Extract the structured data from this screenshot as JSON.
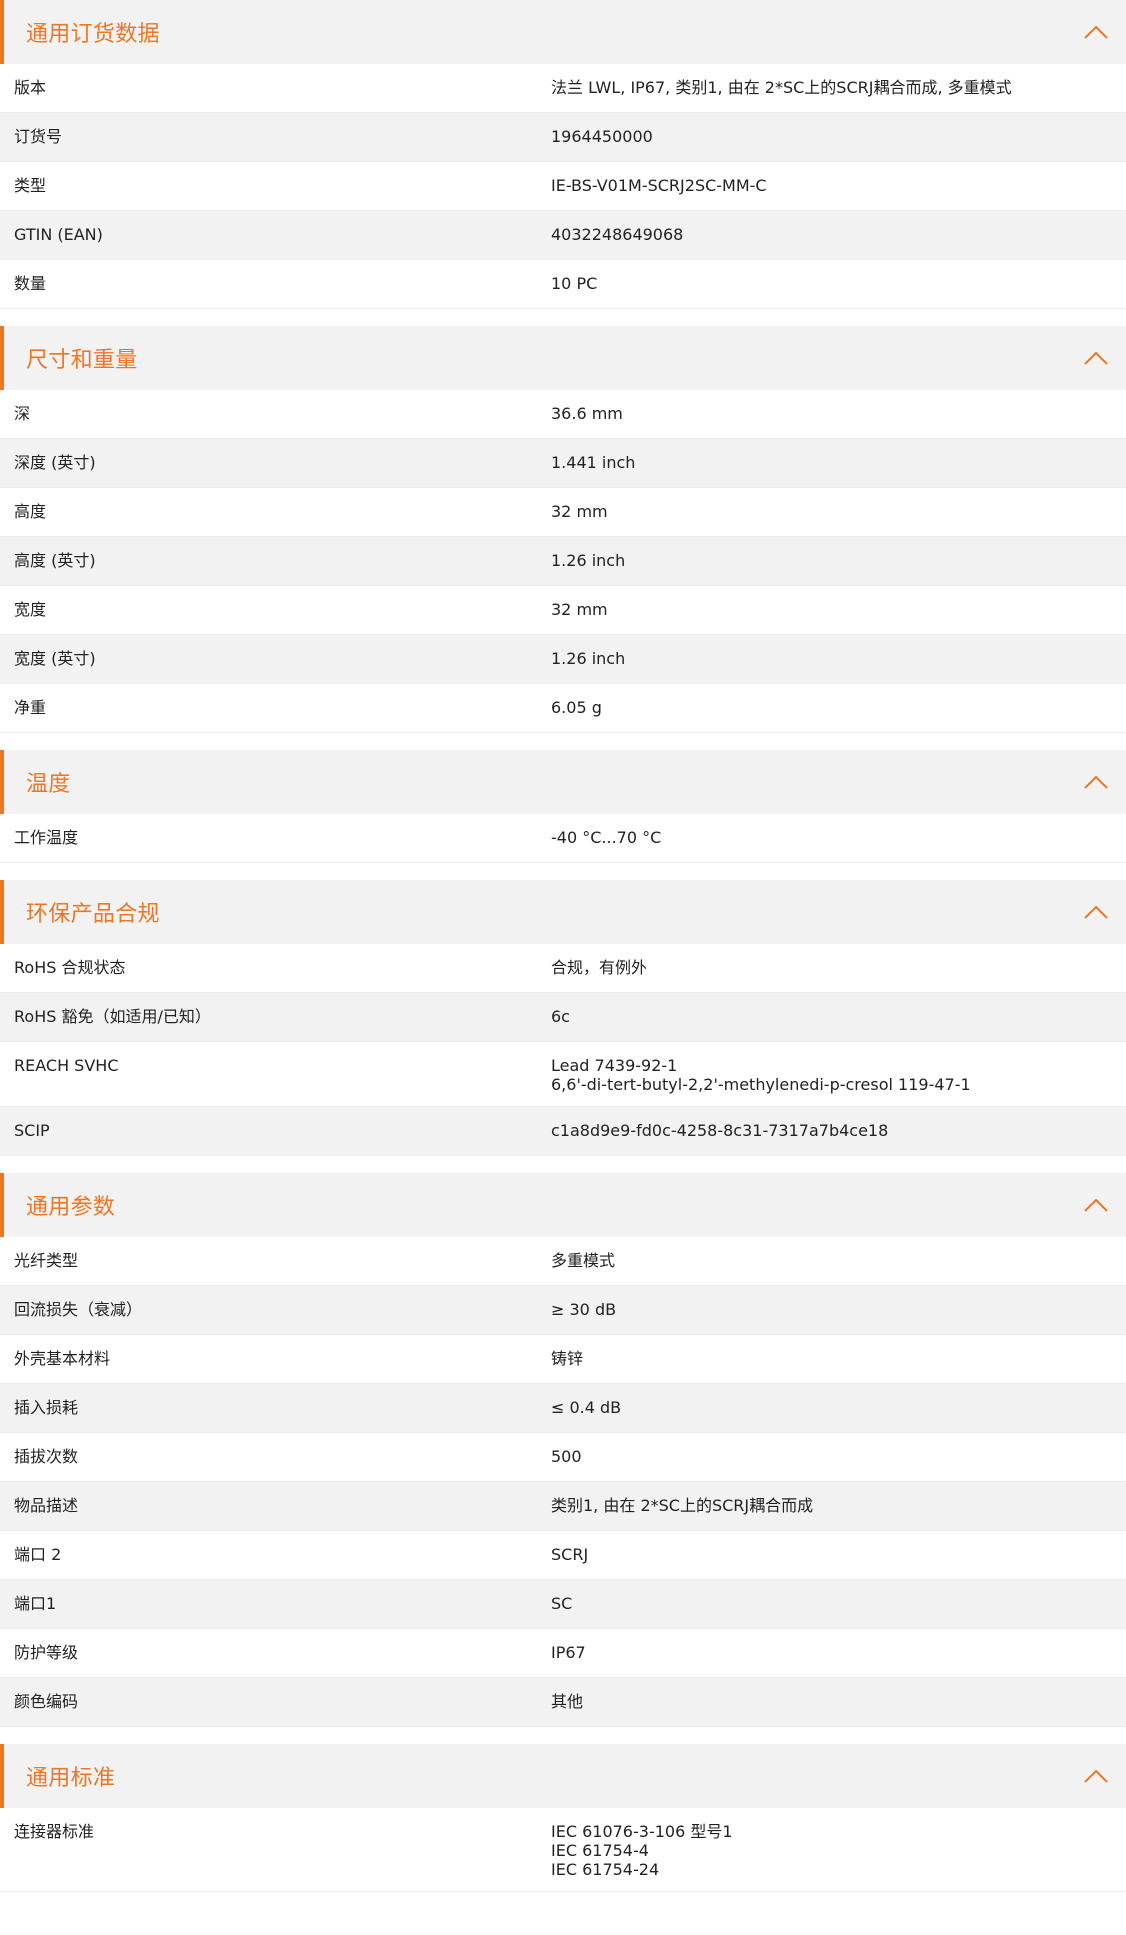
{
  "accent_color": "#ee7623",
  "icons": {
    "collapse": "chevron-up-icon"
  },
  "sections": [
    {
      "title": "通用订货数据",
      "rows": [
        {
          "label": "版本",
          "value": [
            "法兰 LWL, IP67, 类别1, 由在 2*SC上的SCRJ耦合而成, 多重模式"
          ]
        },
        {
          "label": "订货号",
          "value": [
            "1964450000"
          ]
        },
        {
          "label": "类型",
          "value": [
            "IE-BS-V01M-SCRJ2SC-MM-C"
          ]
        },
        {
          "label": "GTIN (EAN)",
          "value": [
            "4032248649068"
          ]
        },
        {
          "label": "数量",
          "value": [
            "10  PC"
          ]
        }
      ]
    },
    {
      "title": "尺寸和重量",
      "rows": [
        {
          "label": "深",
          "value": [
            "36.6  mm"
          ]
        },
        {
          "label": "深度 (英寸)",
          "value": [
            "1.441  inch"
          ]
        },
        {
          "label": "高度",
          "value": [
            "32  mm"
          ]
        },
        {
          "label": "高度 (英寸)",
          "value": [
            "1.26  inch"
          ]
        },
        {
          "label": "宽度",
          "value": [
            "32  mm"
          ]
        },
        {
          "label": "宽度 (英寸)",
          "value": [
            "1.26  inch"
          ]
        },
        {
          "label": "净重",
          "value": [
            "6.05  g"
          ]
        }
      ]
    },
    {
      "title": "温度",
      "rows": [
        {
          "label": "工作温度",
          "value": [
            "-40 °C...70 °C"
          ]
        }
      ]
    },
    {
      "title": "环保产品合规",
      "rows": [
        {
          "label": "RoHS 合规状态",
          "value": [
            "合规，有例外"
          ]
        },
        {
          "label": "RoHS 豁免（如适用/已知）",
          "value": [
            "6c"
          ]
        },
        {
          "label": "REACH SVHC",
          "value": [
            "Lead 7439-92-1",
            "6,6'-di-tert-butyl-2,2'-methylenedi-p-cresol 119-47-1"
          ]
        },
        {
          "label": "SCIP",
          "value": [
            "c1a8d9e9-fd0c-4258-8c31-7317a7b4ce18"
          ]
        }
      ]
    },
    {
      "title": "通用参数",
      "rows": [
        {
          "label": "光纤类型",
          "value": [
            "多重模式"
          ]
        },
        {
          "label": "回流损失（衰减）",
          "value": [
            "≥ 30 dB"
          ]
        },
        {
          "label": "外壳基本材料",
          "value": [
            "铸锌"
          ]
        },
        {
          "label": "插入损耗",
          "value": [
            "≤ 0.4 dB"
          ]
        },
        {
          "label": "插拔次数",
          "value": [
            "500"
          ]
        },
        {
          "label": "物品描述",
          "value": [
            "类别1, 由在 2*SC上的SCRJ耦合而成"
          ]
        },
        {
          "label": "端口 2",
          "value": [
            "SCRJ"
          ]
        },
        {
          "label": "端口1",
          "value": [
            "SC"
          ]
        },
        {
          "label": "防护等级",
          "value": [
            "IP67"
          ]
        },
        {
          "label": "颜色编码",
          "value": [
            "其他"
          ]
        }
      ]
    },
    {
      "title": "通用标准",
      "rows": [
        {
          "label": "连接器标准",
          "value": [
            "IEC 61076-3-106 型号1",
            "IEC 61754-4",
            "IEC 61754-24"
          ]
        }
      ]
    }
  ]
}
